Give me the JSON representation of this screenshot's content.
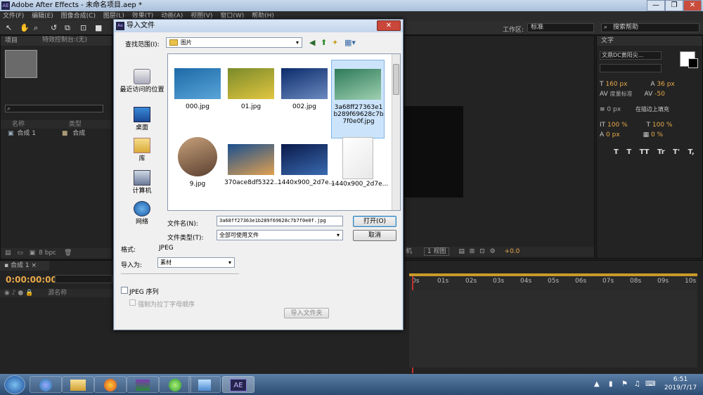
{
  "app": {
    "title": "Adobe After Effects - 未命名项目.aep *",
    "icon": "AE"
  },
  "window_buttons": [
    "—",
    "❐",
    "✕"
  ],
  "menu": [
    "文件(F)",
    "编辑(E)",
    "图像合成(C)",
    "图层(L)",
    "效果(T)",
    "动画(A)",
    "视图(V)",
    "窗口(W)",
    "帮助(H)"
  ],
  "toolbar": {
    "workspace_label": "工作区:",
    "workspace_value": "标准",
    "search_help": "搜索帮助"
  },
  "project_panel": {
    "tab": "项目",
    "effects_tab": "特效控制台:(无)",
    "search_icon": "search-icon",
    "col_name": "名称",
    "col_type": "类型",
    "row_name": "合成 1",
    "row_type": "合成",
    "bpc": "8 bpc"
  },
  "text_panel": {
    "tab": "文字",
    "font": "文鼎DC黄阳尖...",
    "size": "160 px",
    "leading": "36 px",
    "kerning": "度量标准",
    "tracking": "-50",
    "stroke": "0 px",
    "stroke_mode": "在描边上填充",
    "vscale": "100 %",
    "hscale": "100 %",
    "baseline": "0 px",
    "tsume": "0 %",
    "styles": [
      "T",
      "T",
      "TT",
      "Tr",
      "T'",
      "T,"
    ]
  },
  "viewer": {
    "view": "1 视图",
    "offset": "+0.0",
    "mode": "机"
  },
  "timeline": {
    "tab": "合成 1",
    "time": "0:00:00:00",
    "layer_name_col": "源名称",
    "ticks": [
      "0s",
      "01s",
      "02s",
      "03s",
      "04s",
      "05s",
      "06s",
      "07s",
      "08s",
      "09s",
      "10s"
    ]
  },
  "dialog": {
    "title": "导入文件",
    "lookin_label": "查找范围(I):",
    "lookin_value": "图片",
    "places": [
      "最近访问的位置",
      "桌面",
      "库",
      "计算机",
      "网络"
    ],
    "files": [
      {
        "name": "000.jpg",
        "colors": [
          "#1c6aa8",
          "#5aa4d8"
        ]
      },
      {
        "name": "01.jpg",
        "colors": [
          "#7a8a2a",
          "#e2c640"
        ]
      },
      {
        "name": "002.jpg",
        "colors": [
          "#0b2b6b",
          "#6b8ac0"
        ]
      },
      {
        "name": "3a68ff27363e1b289f69628c7b7f0e0f.jpg",
        "colors": [
          "#2e7a5a",
          "#9ed0b0"
        ],
        "selected": true
      },
      {
        "name": "9.jpg",
        "colors": [
          "#c7a07a",
          "#5a4030"
        ]
      },
      {
        "name": "370ace8df5322...",
        "colors": [
          "#1a4f8f",
          "#e0a050"
        ]
      },
      {
        "name": "1440x900_2d7e...",
        "colors": [
          "#0a1a4a",
          "#3a6ab0"
        ]
      },
      {
        "name": "1440x900_2d7e...",
        "colors": [
          "#ffffff",
          "#e8e8e8"
        ],
        "blank": true
      }
    ],
    "filename_label": "文件名(N):",
    "filename_value": "3a68ff27363e1b289f69628c7b7f0e0f.jpg",
    "filetype_label": "文件类型(T):",
    "filetype_value": "全部可使用文件",
    "open_button": "打开(O)",
    "cancel_button": "取消",
    "format_label": "格式:",
    "format_value": "JPEG",
    "import_as_label": "导入为:",
    "import_as_value": "素材",
    "jpeg_seq_label": "JPEG 序列",
    "force_alpha_label": "强制为拉丁字母顺序",
    "import_folder_button": "导入文件夹"
  },
  "taskbar": {
    "clock_time": "6:51",
    "clock_date": "2019/7/17",
    "ae_button": "AE"
  }
}
